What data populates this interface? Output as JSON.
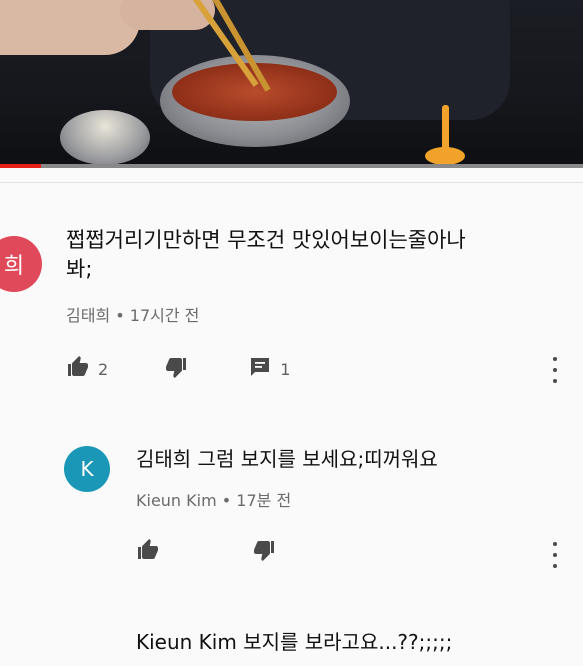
{
  "comment": {
    "avatar_initial": "희",
    "text": "쩝쩝거리기만하면 무조건 맛있어보이는줄아나봐;",
    "author": "김태희",
    "time": "17시간 전",
    "likes": "2",
    "replies": "1"
  },
  "reply": {
    "avatar_initial": "K",
    "text": "김태희 그럼 보지를 보세요;띠꺼워요",
    "author": "Kieun Kim",
    "time": "17분 전"
  },
  "reply2": {
    "text": "Kieun Kim 보지를 보라고요...??;;;;;"
  },
  "video": {
    "progress": 0.07,
    "progress_color": "#e62117"
  }
}
